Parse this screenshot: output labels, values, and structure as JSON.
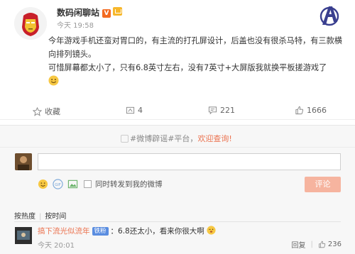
{
  "post": {
    "author": "数码闲聊站",
    "vip_badge": "V",
    "time": "今天 19:58",
    "source": "",
    "content_line1": "今年游戏手机还蛮对胃口的，有主流的打孔屏设计，后盖也没有很杀马特，有三款横向排列镜头。",
    "content_line2": "可惜屏幕都太小了，只有6.8英寸左右，没有7英寸+大屏版我就换平板搓游戏了",
    "brand": "Avengers logo"
  },
  "actions": {
    "favorite_label": "收藏",
    "repost_count": "4",
    "comment_count": "221",
    "like_count": "1666"
  },
  "comment_box": {
    "tag_prefix": "#微博辟谣#平台，",
    "tag_link": "欢迎查询!",
    "input_value": "",
    "also_repost_label": "同时转发到我的微博",
    "submit_label": "评论"
  },
  "sort": {
    "hot_label": "按热度",
    "time_label": "按时间"
  },
  "comments": [
    {
      "user": "搞下流光似流年",
      "badge": "铁粉",
      "text": "：6.8还太小，看来你很大啊",
      "time": "今天 20:01",
      "reply_label": "回复",
      "like_count": "236"
    }
  ],
  "colors": {
    "accent": "#eb7350",
    "submit_disabled": "#f6b49f",
    "badge_blue": "#5a8de0"
  }
}
